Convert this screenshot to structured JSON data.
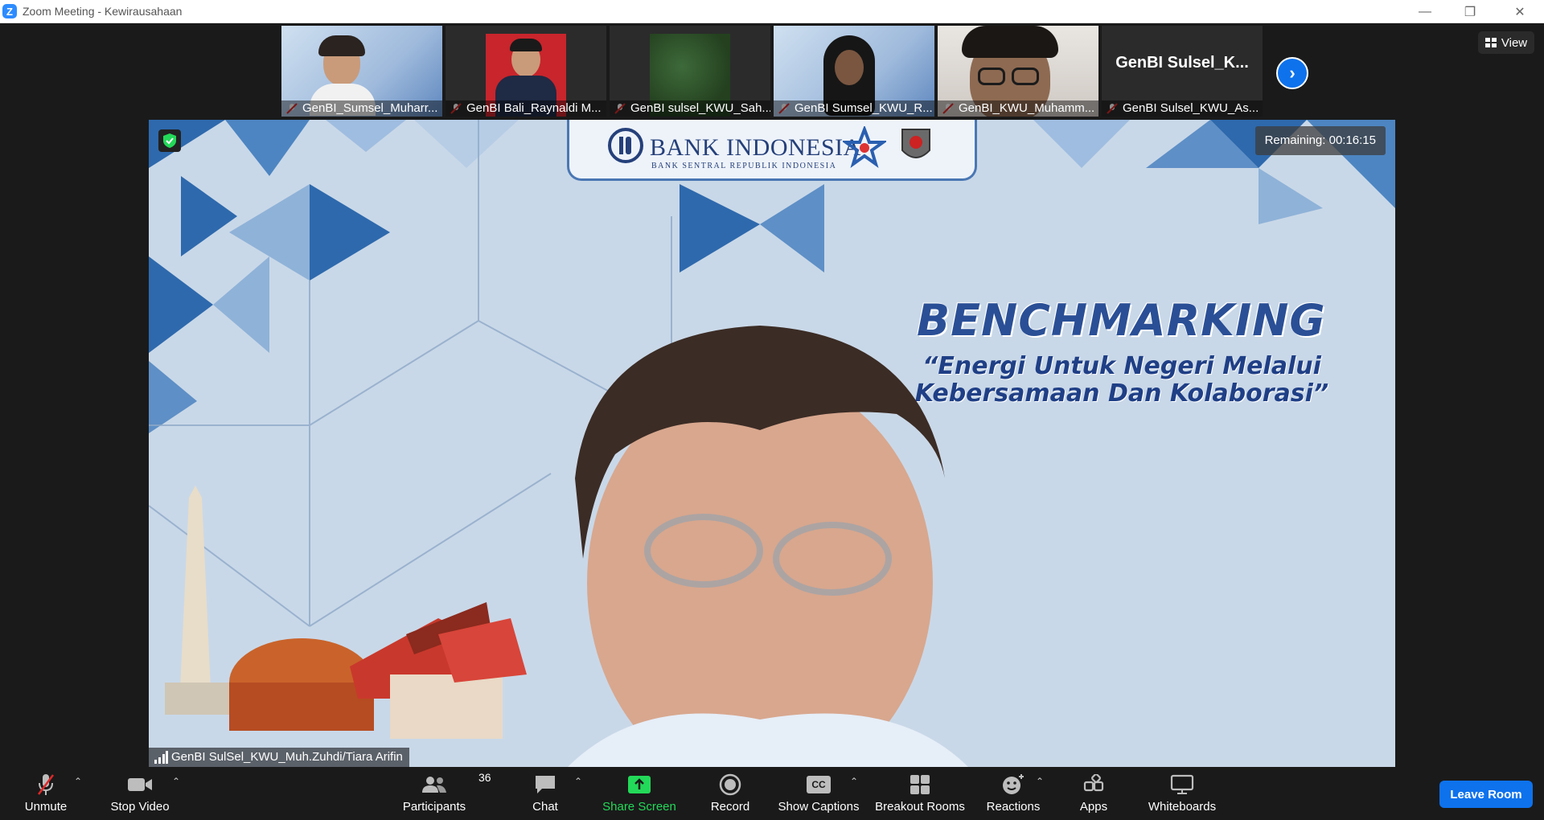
{
  "window": {
    "title": "Zoom Meeting - Kewirausahaan",
    "logo_letter": "Z"
  },
  "gallery": {
    "tiles": [
      {
        "name": "GenBI_Sumsel_Muharr..."
      },
      {
        "name": "GenBI Bali_Raynaldi M..."
      },
      {
        "name": "GenBI sulsel_KWU_Sah..."
      },
      {
        "name": "GenBI Sumsel_KWU_R..."
      },
      {
        "name": "GenBI_KWU_Muhamm..."
      },
      {
        "name": "GenBI Sulsel_KWU_As...",
        "display_text": "GenBI  Sulsel_K..."
      }
    ],
    "view_label": "View"
  },
  "main_video": {
    "remaining": "Remaining: 00:16:15",
    "speaker_name": "GenBI SulSel_KWU_Muh.Zuhdi/Tiara Arifin",
    "slide": {
      "org_title": "BANK INDONESIA",
      "org_subtitle": "BANK SENTRAL REPUBLIK INDONESIA",
      "headline": "BENCHMARKING",
      "tagline_line1": "“Energi Untuk Negeri Melalui",
      "tagline_line2": "Kebersamaan Dan Kolaborasi”"
    }
  },
  "toolbar": {
    "unmute": "Unmute",
    "stop_video": "Stop Video",
    "participants": "Participants",
    "participants_count": "36",
    "chat": "Chat",
    "share_screen": "Share Screen",
    "record": "Record",
    "show_captions": "Show Captions",
    "cc_text": "CC",
    "breakout_rooms": "Breakout Rooms",
    "reactions": "Reactions",
    "apps": "Apps",
    "whiteboards": "Whiteboards",
    "leave_room": "Leave Room"
  },
  "colors": {
    "accent": "#0e72ed",
    "share_green": "#23d959",
    "mute_red": "#e02828"
  }
}
